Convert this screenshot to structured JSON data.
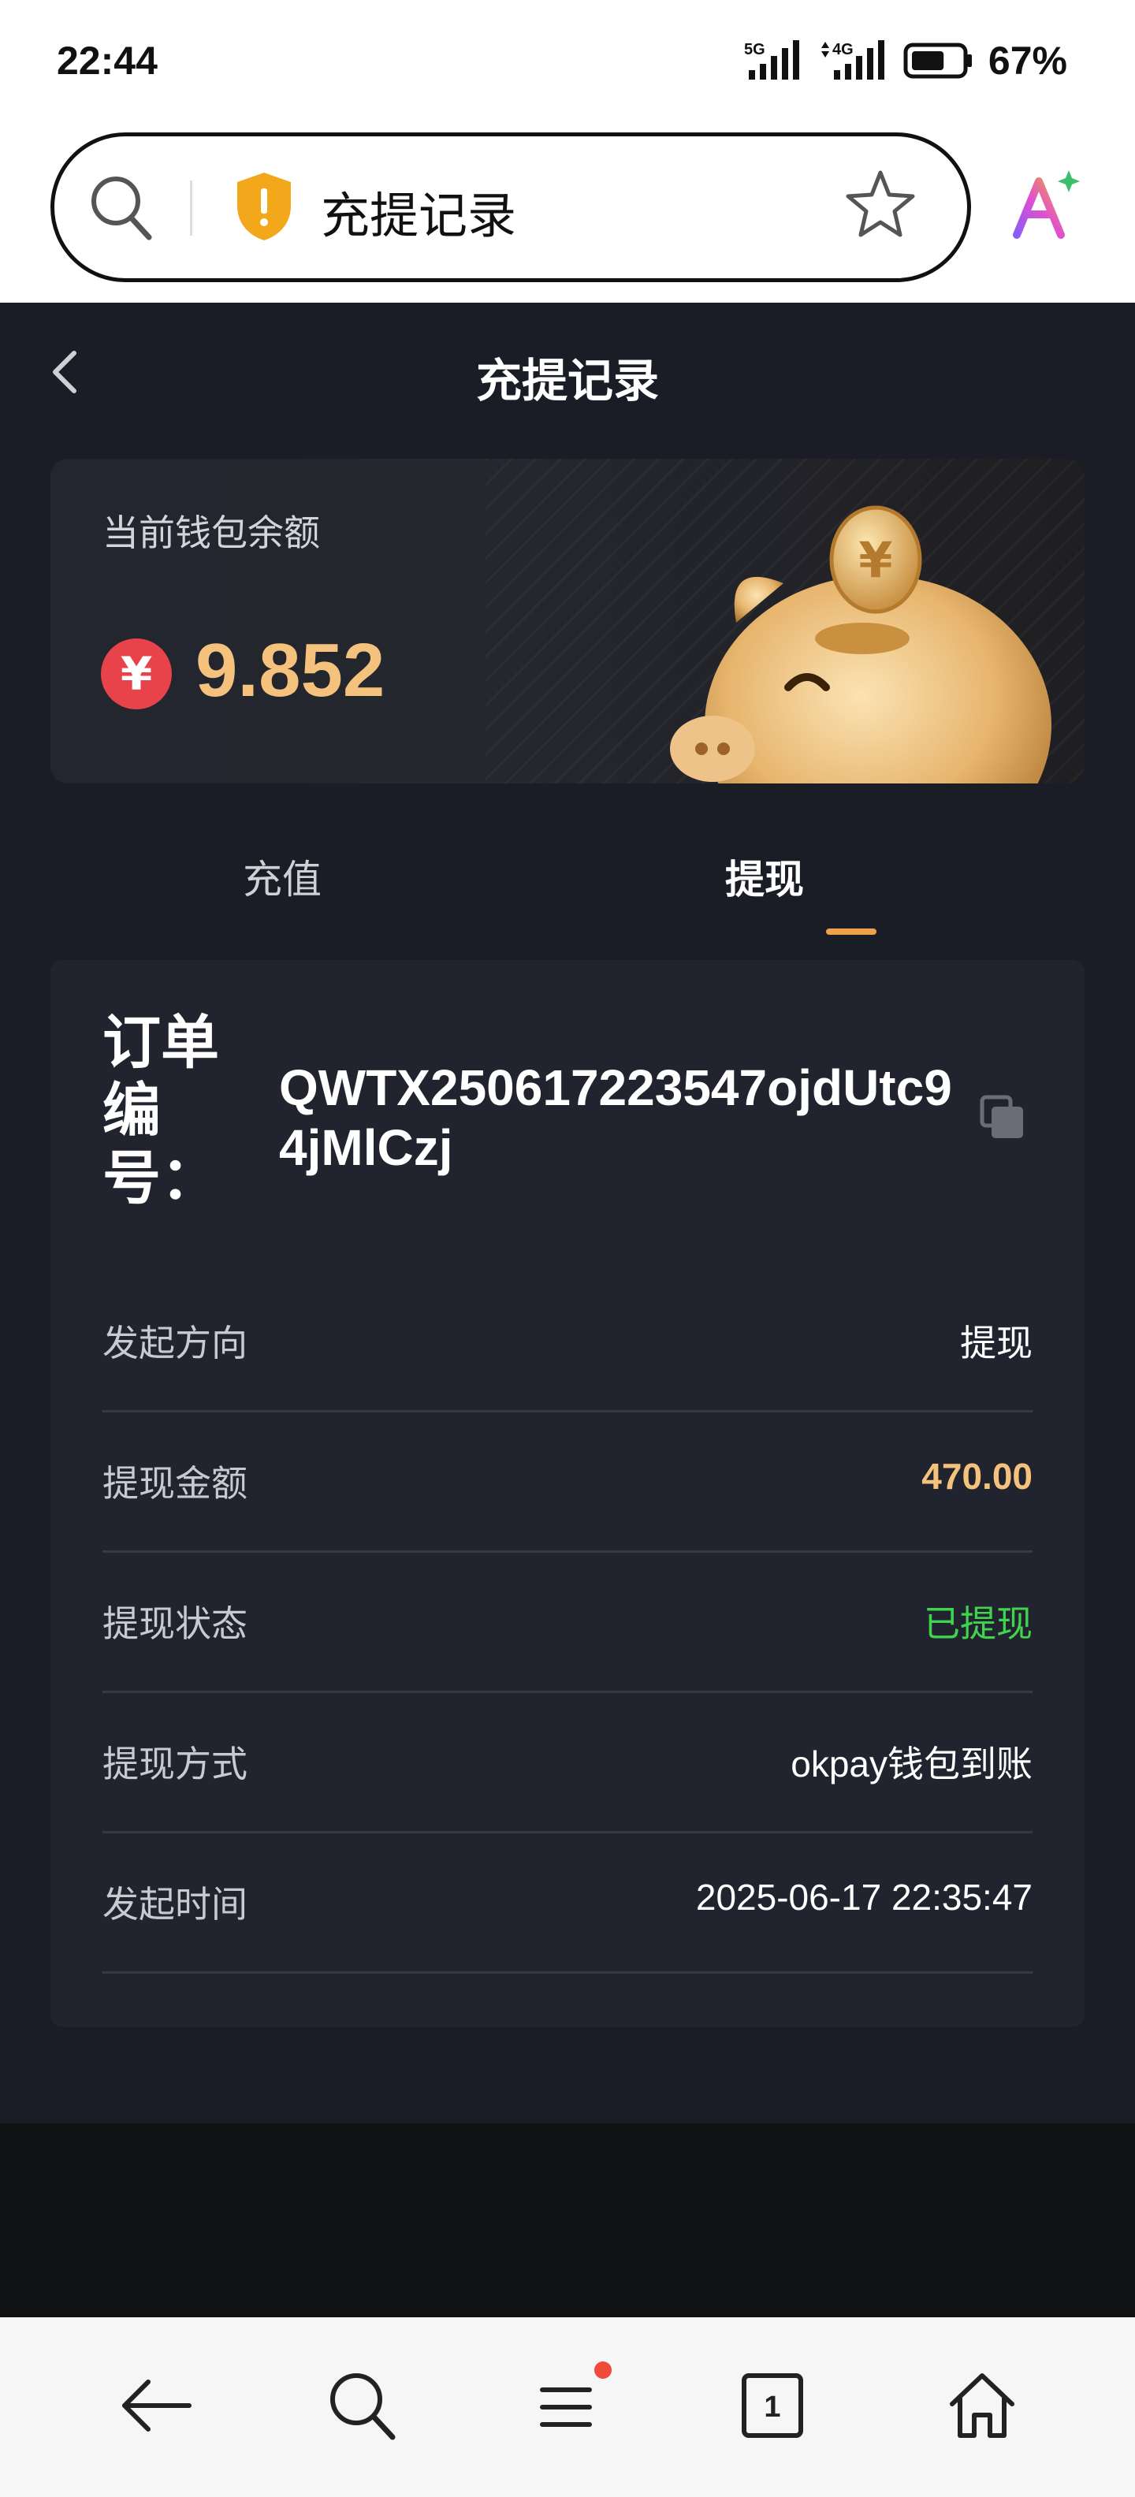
{
  "status_bar": {
    "time": "22:44",
    "signal_1_label": "5G",
    "signal_2_label": "4G",
    "battery_percent": "67%",
    "battery_level": 0.67
  },
  "browser": {
    "address_title": "充提记录",
    "icons": [
      "search-icon",
      "shield-warning-icon",
      "star-icon",
      "ai-assistant-icon"
    ]
  },
  "page": {
    "title": "充提记录"
  },
  "wallet": {
    "label": "当前钱包余额",
    "currency_symbol": "¥",
    "balance": "9.852"
  },
  "tabs": [
    {
      "label": "充值",
      "active": false
    },
    {
      "label": "提现",
      "active": true
    }
  ],
  "order": {
    "label": "订单编号：",
    "number": "QWTX250617223547ojdUtc94jMlCzj"
  },
  "details": [
    {
      "label": "发起方向",
      "value": "提现"
    },
    {
      "label": "提现金额",
      "value": "470.00"
    },
    {
      "label": "提现状态",
      "value": "已提现"
    },
    {
      "label": "提现方式",
      "value": "okpay钱包到账"
    },
    {
      "label": "发起时间",
      "value": "2025-06-17 22:35:47"
    }
  ],
  "colors": {
    "background": "#1a1d26",
    "card": "#21242e",
    "accent_gold": "#f5c27e",
    "tab_indicator": "#f0a04a",
    "status_green": "#3fd44e",
    "yen_red": "#e8424a"
  },
  "nav_bar": {
    "tab_count": "1",
    "icons": [
      "back-arrow-icon",
      "search-icon",
      "menu-icon",
      "tabs-icon",
      "home-icon"
    ]
  }
}
